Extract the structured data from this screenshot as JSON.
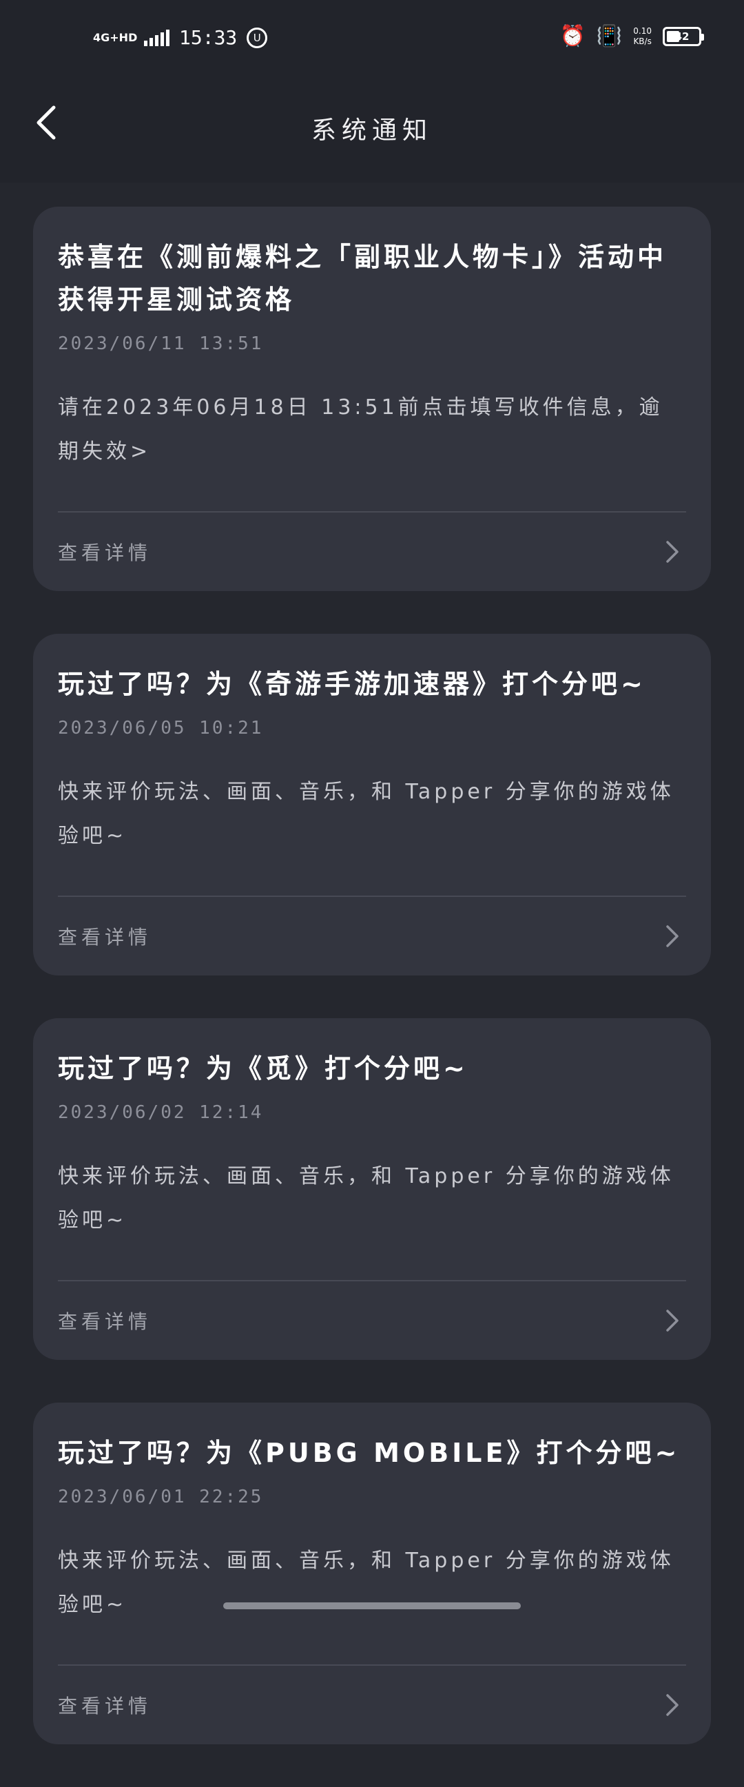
{
  "status_bar": {
    "network": "4G+HD",
    "time": "15:33",
    "notification_badge": "U",
    "net_speed_value": "0.10",
    "net_speed_unit": "KB/s",
    "battery": "42",
    "icons": [
      "signal-icon",
      "alarm-icon",
      "vibrate-icon",
      "battery-icon"
    ]
  },
  "header": {
    "title": "系统通知",
    "back_icon": "chevron-left-icon"
  },
  "notifications": [
    {
      "title": "恭喜在《测前爆料之「副职业人物卡」》活动中获得开星测试资格",
      "date": "2023/06/11 13:51",
      "body": "请在2023年06月18日 13:51前点击填写收件信息，逾期失效>",
      "link": "查看详情"
    },
    {
      "title": "玩过了吗？为《奇游手游加速器》打个分吧~",
      "date": "2023/06/05 10:21",
      "body": "快来评价玩法、画面、音乐，和 Tapper 分享你的游戏体验吧~",
      "link": "查看详情"
    },
    {
      "title": "玩过了吗？为《觅》打个分吧~",
      "date": "2023/06/02 12:14",
      "body": "快来评价玩法、画面、音乐，和 Tapper 分享你的游戏体验吧~",
      "link": "查看详情"
    },
    {
      "title": "玩过了吗？为《PUBG MOBILE》打个分吧~",
      "date": "2023/06/01 22:25",
      "body": "快来评价玩法、画面、音乐，和 Tapper 分享你的游戏体验吧~",
      "link": "查看详情"
    }
  ],
  "colors": {
    "background": "#25272e",
    "card": "#33353f",
    "title": "#ffffff",
    "secondary": "#8e909a"
  }
}
